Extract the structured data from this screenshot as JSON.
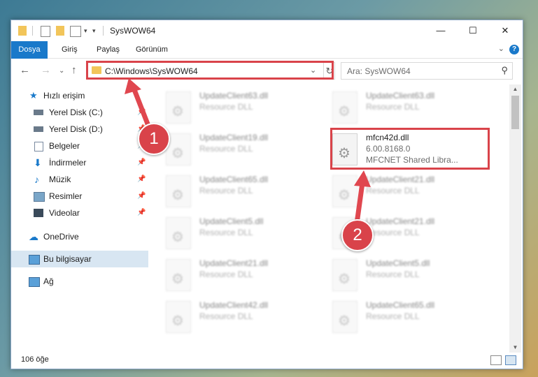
{
  "window": {
    "title": "SysWOW64",
    "minimize": "—",
    "maximize": "☐",
    "close": "✕"
  },
  "ribbon": {
    "tabs": [
      "Dosya",
      "Giriş",
      "Paylaş",
      "Görünüm"
    ],
    "help": "?"
  },
  "navigation": {
    "address": "C:\\Windows\\SysWOW64",
    "search_placeholder": "Ara: SysWOW64"
  },
  "sidebar": {
    "quick_access": "Hızlı erişim",
    "items": [
      {
        "label": "Yerel Disk (C:)",
        "pinned": true
      },
      {
        "label": "Yerel Disk (D:)",
        "pinned": true
      },
      {
        "label": "Belgeler",
        "pinned": true
      },
      {
        "label": "İndirmeler",
        "pinned": true
      },
      {
        "label": "Müzik",
        "pinned": true
      },
      {
        "label": "Resimler",
        "pinned": true
      },
      {
        "label": "Videolar",
        "pinned": true
      }
    ],
    "onedrive": "OneDrive",
    "this_pc": "Bu bilgisayar",
    "network": "Ağ"
  },
  "files": {
    "left": [
      {
        "name": "UpdateClient63.dll",
        "type": "Resource DLL"
      },
      {
        "name": "UpdateClient19.dll",
        "type": "Resource DLL"
      },
      {
        "name": "UpdateClient65.dll",
        "type": "Resource DLL"
      },
      {
        "name": "UpdateClient5.dll",
        "type": "Resource DLL"
      },
      {
        "name": "UpdateClient21.dll",
        "type": "Resource DLL"
      },
      {
        "name": "UpdateClient42.dll",
        "type": "Resource DLL"
      }
    ],
    "right": [
      {
        "name": "UpdateClient63.dll",
        "type": "Resource DLL"
      },
      {
        "name": "mfcn42d.dll",
        "version": "6.00.8168.0",
        "type": "MFCNET Shared Libra..."
      },
      {
        "name": "UpdateClient21.dll",
        "type": "Resource DLL"
      },
      {
        "name": "UpdateClient21.dll",
        "type": "Resource DLL"
      },
      {
        "name": "UpdateClient5.dll",
        "type": "Resource DLL"
      },
      {
        "name": "UpdateClient65.dll",
        "type": "Resource DLL"
      }
    ]
  },
  "status": {
    "count": "106 öğe"
  },
  "annotations": {
    "step1": "1",
    "step2": "2",
    "color": "#d9434a"
  }
}
